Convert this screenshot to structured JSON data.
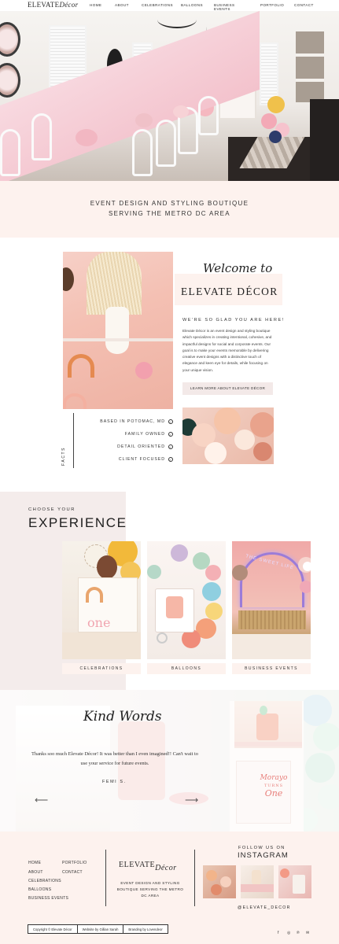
{
  "brand": {
    "name_main": "ELEVATE",
    "name_script": "Décor"
  },
  "nav": {
    "links": [
      "HOME",
      "ABOUT",
      "CELEBRATIONS",
      "BALLOONS",
      "BUSINESS EVENTS",
      "PORTFOLIO",
      "CONTACT"
    ]
  },
  "tagline": {
    "line1": "EVENT DESIGN AND STYLING BOUTIQUE",
    "line2": "SERVING THE METRO DC AREA"
  },
  "welcome": {
    "script": "Welcome to",
    "title": "ELEVATE DÉCOR",
    "eyebrow": "WE'RE SO GLAD YOU ARE HERE!",
    "body": [
      "Elevate Décor is an event design and styling boutique",
      "which specializes in creating intentional, cohesive, and",
      "impactful designs for social and corporate events. Our",
      "goal is to make your events memorable by delivering",
      "creative event designs with a distinctive touch of",
      "elegance and keen eye for details, while focusing on",
      "your unique vision."
    ],
    "button": "LEARN MORE ABOUT ELEVATE DÉCOR"
  },
  "facts": {
    "label": "FACTS",
    "items": [
      "BASED IN POTOMAC, MD",
      "FAMILY OWNED",
      "DETAIL ORIENTED",
      "CLIENT FOCUSED"
    ]
  },
  "experience": {
    "eyebrow": "CHOOSE YOUR",
    "title": "EXPERIENCE",
    "cards": [
      "CELEBRATIONS",
      "BALLOONS",
      "BUSINESS EVENTS"
    ],
    "neon_text": "THE SWEET LIFE",
    "cake_text": "one"
  },
  "kind_words": {
    "script": "Kind Words",
    "quote": "Thanks soo much Elevate Décor! It was better than I even imagined!! Can't wait to use your service for future events.",
    "author": "FEMI S.",
    "prev_arrow": "⟵",
    "next_arrow": "⟶",
    "sign_text_1": "Morayo",
    "sign_text_2": "TURNS",
    "sign_text_3": "One"
  },
  "footer": {
    "col1": [
      "HOME",
      "ABOUT",
      "CELEBRATIONS",
      "BALLOONS",
      "BUSINESS EVENTS"
    ],
    "col2": [
      "PORTFOLIO",
      "CONTACT"
    ],
    "brand_main": "ELEVATE",
    "brand_script": "Décor",
    "tagline": [
      "EVENT DESIGN AND STYLING",
      "BOUTIQUE SERVING THE METRO",
      "DC AREA"
    ],
    "follow": "FOLLOW US ON",
    "instagram": "INSTAGRAM",
    "handle": "@ELEVATE_DECOR",
    "copyright": "Copyright © Elevate Décor",
    "website_by": "Website by Gillian Sarah",
    "branding_by": "Branding by Lovendeor",
    "social_icons": [
      "facebook-icon",
      "instagram-icon",
      "pinterest-icon",
      "email-icon"
    ]
  },
  "colors": {
    "blush": "#fdf2ee",
    "mauve_bg": "#f4eceb",
    "text": "#2b2b2b"
  }
}
